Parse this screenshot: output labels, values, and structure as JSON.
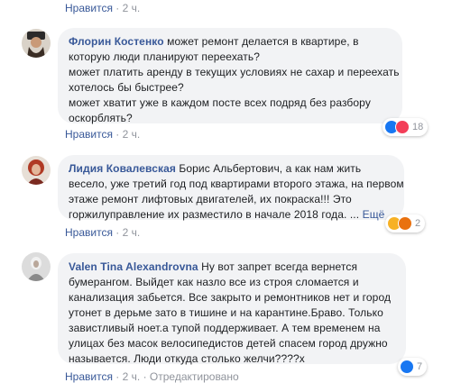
{
  "top_meta": {
    "like": "Нравится",
    "sep": "·",
    "time": "2 ч."
  },
  "comments": [
    {
      "author": "Флорин Костенко",
      "lines": [
        "может ремонт делается в квартире, в",
        "которую люди планируют переехать?",
        "может платить аренду в текущих условиях не сахар и переехать",
        "хотелось бы быстрее?",
        "может хватит уже в каждом посте всех подряд без разбору",
        "оскорблять?"
      ],
      "like": "Нравится",
      "sep": "·",
      "time": "2 ч.",
      "reactions": {
        "icons": [
          "like-icon",
          "love-icon"
        ],
        "count": "18"
      }
    },
    {
      "author": "Лидия Ковалевская",
      "lines": [
        "Борис Альбертович, а как нам жить",
        "весело, уже третий год под квартирами второго этажа, на первом",
        "этаже ремонт лифтовых двигателей, их покраска!!! Это",
        "горжилуправление их разместило в начале 2018 года. ..."
      ],
      "more": "Ещё",
      "like": "Нравится",
      "sep": "·",
      "time": "2 ч.",
      "reactions": {
        "icons": [
          "sad-icon",
          "angry-icon"
        ],
        "count": "2"
      }
    },
    {
      "author": "Valen Tina Alexandrovna",
      "lines": [
        "Ну вот запрет всегда вернется",
        "бумерангом. Выйдет как назло все из строя сломается и",
        "канализация забьется. Все закрыто и ремонтников нет и город",
        "утонет в дерьме зато в тишине и на карантине.Браво. Только",
        "завистливый ноет.а тупой поддерживает. А тем временем на",
        "улицах без масок велосипедистов детей спасем город дружно",
        "называется. Люди откуда столько желчи????х"
      ],
      "like": "Нравится",
      "sep": "·",
      "time": "2 ч.",
      "edited": "Отредактировано",
      "reactions": {
        "icons": [
          "like-icon"
        ],
        "count": "7"
      }
    }
  ],
  "colors": {
    "link": "#385898",
    "meta": "#90949c",
    "bubble": "#f2f3f5",
    "like": "#1877f2",
    "love": "#f33e58",
    "sad": "#f7b125"
  }
}
